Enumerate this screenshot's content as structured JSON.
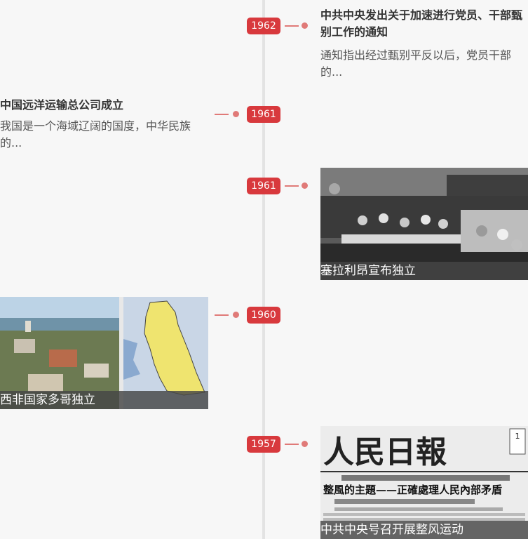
{
  "events": [
    {
      "year": "1962",
      "title": "中共中央发出关于加速进行党员、干部甄别工作的通知",
      "desc": "通知指出经过甄别平反以后，党员干部的..."
    },
    {
      "year": "1961",
      "title": "中国远洋运输总公司成立",
      "desc": "我国是一个海域辽阔的国度，中华民族的..."
    },
    {
      "year": "1961",
      "caption": "塞拉利昂宣布独立"
    },
    {
      "year": "1960",
      "caption": "西非国家多哥独立"
    },
    {
      "year": "1957",
      "caption": "中共中央号召开展整风运动"
    }
  ],
  "newspaper": {
    "masthead": "人民日報",
    "headline": "整風的主題——正確處理人民內部矛盾"
  }
}
